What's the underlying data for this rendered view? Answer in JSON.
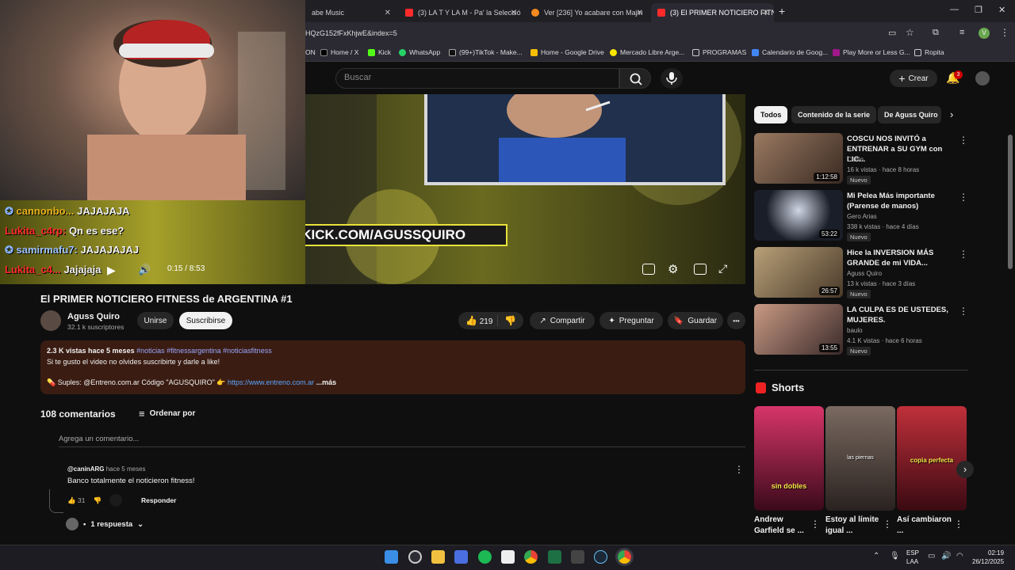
{
  "browser": {
    "tabs": [
      {
        "label": "abe Music",
        "color": "#ff3b3b"
      },
      {
        "label": "(3) LA T Y LA M - Pa' la Selecció",
        "color": "#ff2a2a"
      },
      {
        "label": "Ver [236] Yo acabare con Majin",
        "color": "#f58a1f"
      },
      {
        "label": "(3) El PRIMER NOTICIERO FITNE",
        "color": "#ff2a2a"
      }
    ],
    "url": "HQzG152fFxKhjwE&index=5",
    "bookmarks": [
      "ON",
      "Home / X",
      "Kick",
      "WhatsApp",
      "(99+)TikTok - Make...",
      "Home - Google Drive",
      "Mercado Libre Arge...",
      "PROGRAMAS",
      "Calendario de Goog...",
      "Play More or Less G...",
      "Ropita"
    ]
  },
  "header": {
    "search_placeholder": "Buscar",
    "create_label": "Crear",
    "notification_count": "3"
  },
  "stream_overlay": {
    "chat": [
      {
        "user": "cannonbo...",
        "message": "JAJAJAJA",
        "color": "#e8b21c"
      },
      {
        "user": "Lukita_c4rp:",
        "message": "Qn es ese?",
        "color": "#ff2a2a"
      },
      {
        "user": "samirmafu7:",
        "message": "JAJAJAJAJ",
        "color": "#9ec2ff"
      },
      {
        "user": "Lukita_c4...",
        "message": "Jajajaja",
        "color": "#ff2a2a"
      }
    ],
    "banner": "KICK.COM/AGUSSQUIRO",
    "banner_logo": "K"
  },
  "player": {
    "time": "0:15 / 8:53"
  },
  "video": {
    "title": "El PRIMER NOTICIERO FITNESS de ARGENTINA #1",
    "channel": "Aguss Quiro",
    "subscribers": "32.1 k suscriptores",
    "join_label": "Unirse",
    "subscribe_label": "Suscribirse",
    "likes": "219",
    "share_label": "Compartir",
    "ask_label": "Preguntar",
    "save_label": "Guardar",
    "more_label": "•••"
  },
  "description": {
    "meta": "2.3 K vistas  hace 5 meses",
    "tags": "#noticias #fitnessargentina #noticiasfitness",
    "line1": "Si te gusto el video no olvides suscribirte y darle a like!",
    "line2": "Suples: @Entreno.com.ar Código \"AGUSQUIRO\" 👉 ",
    "link": "https://www.entreno.com.ar",
    "more": "...más"
  },
  "comments": {
    "count_label": "108 comentarios",
    "sort_label": "Ordenar por",
    "add_placeholder": "Agrega un comentario...",
    "items": [
      {
        "author": "@caninARG",
        "time": "hace 5 meses",
        "text": "Banco totalmente el noticieron fitness!",
        "likes": "31",
        "reply_label": "Responder",
        "replies_label": "1 respuesta"
      }
    ]
  },
  "sidebar": {
    "chips": [
      "Todos",
      "Contenido de la serie",
      "De Aguss Quiro"
    ],
    "videos": [
      {
        "title": "COSCU NOS INVITÓ a ENTRENAR a SU GYM con LIC...",
        "channel": "Canin",
        "meta": "16 k vistas · hace 8 horas",
        "duration": "1:12:58",
        "badge": "Nuevo",
        "thumb": "#7a5a48"
      },
      {
        "title": "Mi Pelea Más importante (Parense de manos)",
        "channel": "Gero Arias",
        "meta": "338 k vistas · hace 4 días",
        "duration": "53:22",
        "badge": "Nuevo",
        "thumb": "#2a2f3a"
      },
      {
        "title": "Hice la INVERSION MÁS GRANDE de mi VIDA...",
        "channel": "Aguss Quiro",
        "meta": "13 k vistas · hace 3 días",
        "duration": "26:57",
        "badge": "Nuevo",
        "thumb": "#8a7a58"
      },
      {
        "title": "LA CULPA ES DE USTEDES, MUJERES.",
        "channel": "baulo",
        "meta": "4.1 K vistas · hace 6 horas",
        "duration": "13:55",
        "badge": "Nuevo",
        "thumb": "#6a5048"
      }
    ],
    "shorts_title": "Shorts",
    "shorts": [
      {
        "title": "Andrew Garfield se ...",
        "caption": "sin dobles",
        "color": "#8a1a3a"
      },
      {
        "title": "Estoy al límite igual ...",
        "caption": "las piernas",
        "color": "#5a4a40"
      },
      {
        "title": "Así cambiaron ...",
        "caption": "copia perfecta",
        "color": "#7a1a2a"
      }
    ]
  },
  "taskbar": {
    "lang_top": "ESP",
    "lang_bottom": "LAA",
    "time": "02:19",
    "date": "26/12/2025"
  }
}
